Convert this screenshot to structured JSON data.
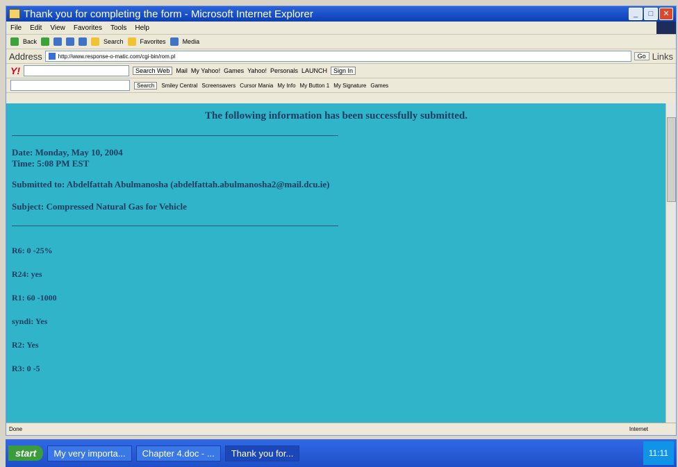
{
  "window": {
    "title": "Thank you for completing the form - Microsoft Internet Explorer"
  },
  "menu": [
    "File",
    "Edit",
    "View",
    "Favorites",
    "Tools",
    "Help"
  ],
  "toolbar": {
    "back": "Back",
    "search": "Search",
    "favorites": "Favorites",
    "media": "Media"
  },
  "address": {
    "label": "Address",
    "url": "http://www.response-o-matic.com/cgi-bin/rom.pl",
    "go": "Go",
    "links": "Links"
  },
  "yahoo": {
    "search_button": "Search Web",
    "items": [
      "Mail",
      "My Yahoo!",
      "Games",
      "Yahoo!",
      "Personals",
      "LAUNCH",
      "Sign In"
    ]
  },
  "bar4": {
    "search": "Search",
    "items": [
      "Smiley Central",
      "Screensavers",
      "Cursor Mania",
      "My Info",
      "My Button 1",
      "My Signature",
      "Games"
    ]
  },
  "content": {
    "headline": "The following information has been successfully submitted.",
    "date": "Date: Monday, May 10, 2004",
    "time": "Time: 5:08 PM EST",
    "submitted_to": "Submitted to: Abdelfattah Abulmanosha (abdelfattah.abulmanosha2@mail.dcu.ie)",
    "subject": "Subject: Compressed Natural Gas for Vehicle",
    "answers": [
      "R6: 0 -25%",
      "R24: yes",
      "R1: 60 -1000",
      "syndi: Yes",
      "R2: Yes",
      "R3: 0 -5"
    ]
  },
  "status": {
    "text": "Done",
    "zone": "Internet"
  },
  "taskbar": {
    "start": "start",
    "buttons": [
      "My very importa...",
      "Chapter 4.doc - ...",
      "Thank you for..."
    ],
    "clock": "11:11"
  }
}
